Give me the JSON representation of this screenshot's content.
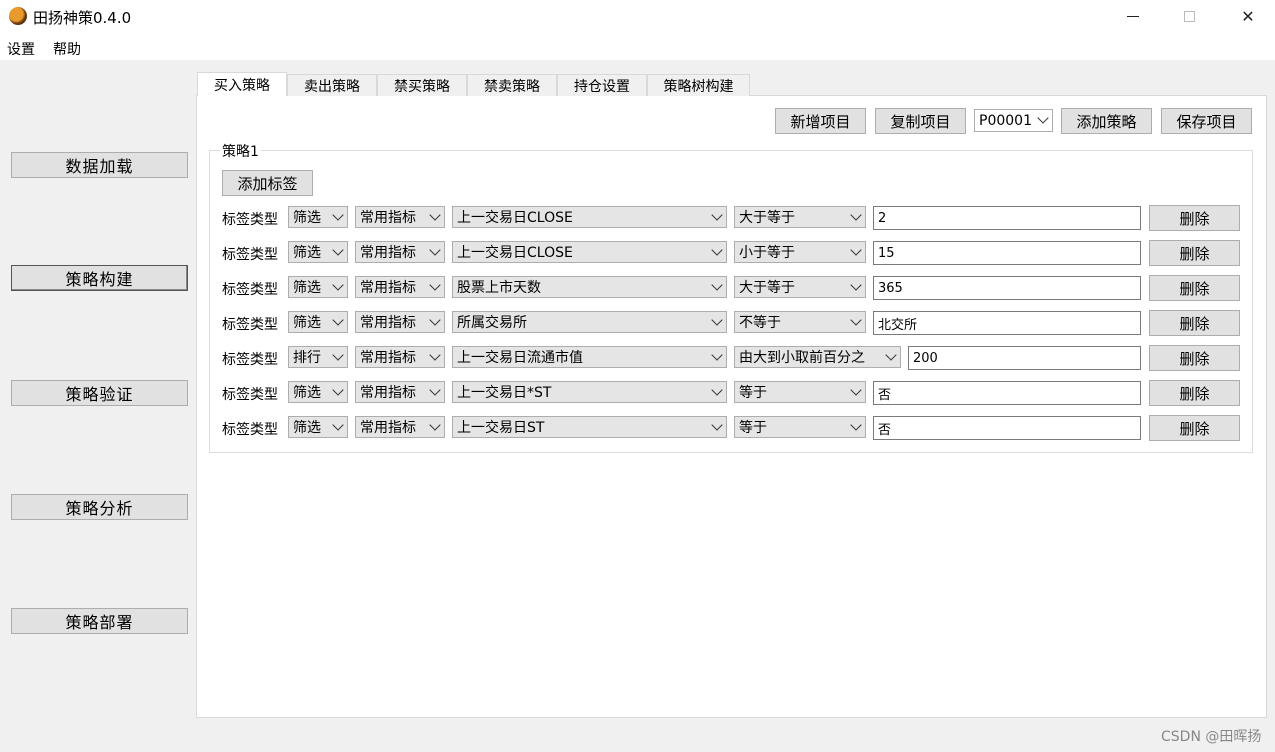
{
  "window": {
    "title": "田扬神策0.4.0"
  },
  "menu": [
    "设置",
    "帮助"
  ],
  "nav": [
    "数据加载",
    "策略构建",
    "策略验证",
    "策略分析",
    "策略部署"
  ],
  "tabs": [
    "买入策略",
    "卖出策略",
    "禁买策略",
    "禁卖策略",
    "持仓设置",
    "策略树构建"
  ],
  "toolbar": {
    "new_project": "新增项目",
    "copy_project": "复制项目",
    "project_select": "P00001",
    "add_strategy": "添加策略",
    "save_project": "保存项目"
  },
  "strategy": {
    "title": "策略1",
    "add_tag": "添加标签",
    "rows": [
      {
        "label": "标签类型",
        "type": "筛选",
        "category": "常用指标",
        "indicator": "上一交易日CLOSE",
        "operator": "大于等于",
        "value": "2",
        "delete": "删除"
      },
      {
        "label": "标签类型",
        "type": "筛选",
        "category": "常用指标",
        "indicator": "上一交易日CLOSE",
        "operator": "小于等于",
        "value": "15",
        "delete": "删除"
      },
      {
        "label": "标签类型",
        "type": "筛选",
        "category": "常用指标",
        "indicator": "股票上市天数",
        "operator": "大于等于",
        "value": "365",
        "delete": "删除"
      },
      {
        "label": "标签类型",
        "type": "筛选",
        "category": "常用指标",
        "indicator": "所属交易所",
        "operator": "不等于",
        "value": "北交所",
        "delete": "删除"
      },
      {
        "label": "标签类型",
        "type": "排行",
        "category": "常用指标",
        "indicator": "上一交易日流通市值",
        "operator": "由大到小取前百分之",
        "value": "200",
        "delete": "删除"
      },
      {
        "label": "标签类型",
        "type": "筛选",
        "category": "常用指标",
        "indicator": "上一交易日*ST",
        "operator": "等于",
        "value": "否",
        "delete": "删除"
      },
      {
        "label": "标签类型",
        "type": "筛选",
        "category": "常用指标",
        "indicator": "上一交易日ST",
        "operator": "等于",
        "value": "否",
        "delete": "删除"
      }
    ]
  },
  "watermark": "CSDN @田晖扬"
}
